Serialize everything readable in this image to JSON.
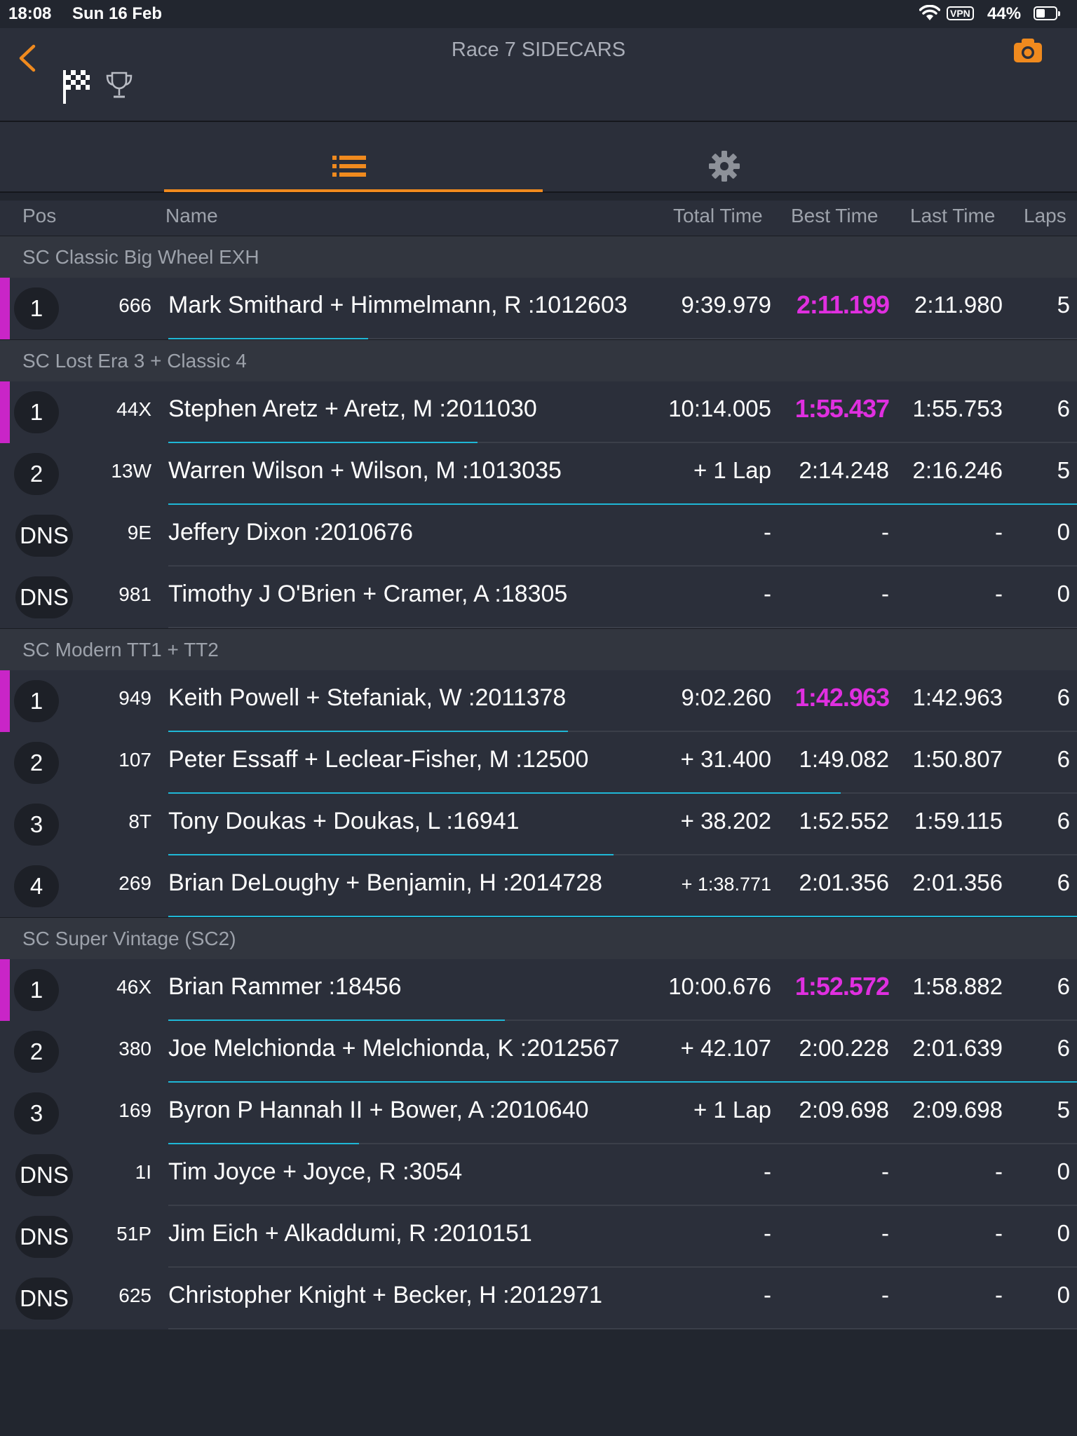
{
  "status_bar": {
    "time": "18:08",
    "date": "Sun 16 Feb",
    "vpn": "VPN",
    "battery": "44%"
  },
  "header": {
    "title": "Race 7  SIDECARS"
  },
  "colors": {
    "accent": "#f08a1e",
    "fastest": "#e02fe0",
    "progress": "#1fb7d6",
    "background": "#22262f"
  },
  "columns": {
    "pos": "Pos",
    "name": "Name",
    "total": "Total Time",
    "best": "Best Time",
    "last": "Last Time",
    "laps": "Laps"
  },
  "classes": [
    {
      "name": "SC Classic Big Wheel EXH",
      "rows": [
        {
          "pos": "1",
          "num": "666",
          "name": "Mark Smithard + Himmelmann, R :1012603",
          "total": "9:39.979",
          "best": "2:11.199",
          "last": "2:11.980",
          "laps": "5",
          "leader": true,
          "progress": 0.22
        }
      ]
    },
    {
      "name": "SC Lost Era 3 + Classic 4",
      "rows": [
        {
          "pos": "1",
          "num": "44X",
          "name": "Stephen Aretz + Aretz, M :2011030",
          "total": "10:14.005",
          "best": "1:55.437",
          "last": "1:55.753",
          "laps": "6",
          "leader": true,
          "progress": 0.34
        },
        {
          "pos": "2",
          "num": "13W",
          "name": "Warren Wilson + Wilson, M :1013035",
          "total": "+ 1 Lap",
          "best": "2:14.248",
          "last": "2:16.246",
          "laps": "5",
          "leader": false,
          "progress": 1.0
        },
        {
          "pos": "DNS",
          "num": "9E",
          "name": "Jeffery Dixon :2010676",
          "total": "-",
          "best": "-",
          "last": "-",
          "laps": "0",
          "leader": false,
          "progress": 0
        },
        {
          "pos": "DNS",
          "num": "981",
          "name": "Timothy J O'Brien + Cramer, A :18305",
          "total": "-",
          "best": "-",
          "last": "-",
          "laps": "0",
          "leader": false,
          "progress": 0
        }
      ]
    },
    {
      "name": "SC Modern TT1 + TT2",
      "rows": [
        {
          "pos": "1",
          "num": "949",
          "name": "Keith Powell + Stefaniak, W :2011378",
          "total": "9:02.260",
          "best": "1:42.963",
          "last": "1:42.963",
          "laps": "6",
          "leader": true,
          "progress": 0.44
        },
        {
          "pos": "2",
          "num": "107",
          "name": "Peter Essaff + Leclear-Fisher, M :12500",
          "total": "+ 31.400",
          "best": "1:49.082",
          "last": "1:50.807",
          "laps": "6",
          "leader": false,
          "progress": 0.74
        },
        {
          "pos": "3",
          "num": "8T",
          "name": "Tony Doukas + Doukas, L :16941",
          "total": "+ 38.202",
          "best": "1:52.552",
          "last": "1:59.115",
          "laps": "6",
          "leader": false,
          "progress": 0.49
        },
        {
          "pos": "4",
          "num": "269",
          "name": "Brian DeLoughy + Benjamin, H :2014728",
          "total": "+ 1:38.771",
          "best": "2:01.356",
          "last": "2:01.356",
          "laps": "6",
          "leader": false,
          "progress": 1.0,
          "small_total": true
        }
      ]
    },
    {
      "name": "SC Super Vintage (SC2)",
      "rows": [
        {
          "pos": "1",
          "num": "46X",
          "name": "Brian Rammer :18456",
          "total": "10:00.676",
          "best": "1:52.572",
          "last": "1:58.882",
          "laps": "6",
          "leader": true,
          "progress": 0.37
        },
        {
          "pos": "2",
          "num": "380",
          "name": "Joe Melchionda + Melchionda, K :2012567",
          "total": "+ 42.107",
          "best": "2:00.228",
          "last": "2:01.639",
          "laps": "6",
          "leader": false,
          "progress": 1.0
        },
        {
          "pos": "3",
          "num": "169",
          "name": "Byron P Hannah II + Bower, A :2010640",
          "total": "+ 1 Lap",
          "best": "2:09.698",
          "last": "2:09.698",
          "laps": "5",
          "leader": false,
          "progress": 0.21
        },
        {
          "pos": "DNS",
          "num": "1I",
          "name": "Tim Joyce + Joyce, R :3054",
          "total": "-",
          "best": "-",
          "last": "-",
          "laps": "0",
          "leader": false,
          "progress": 0
        },
        {
          "pos": "DNS",
          "num": "51P",
          "name": "Jim Eich + Alkaddumi, R :2010151",
          "total": "-",
          "best": "-",
          "last": "-",
          "laps": "0",
          "leader": false,
          "progress": 0
        },
        {
          "pos": "DNS",
          "num": "625",
          "name": "Christopher Knight + Becker, H :2012971",
          "total": "-",
          "best": "-",
          "last": "-",
          "laps": "0",
          "leader": false,
          "progress": 0
        }
      ]
    }
  ]
}
